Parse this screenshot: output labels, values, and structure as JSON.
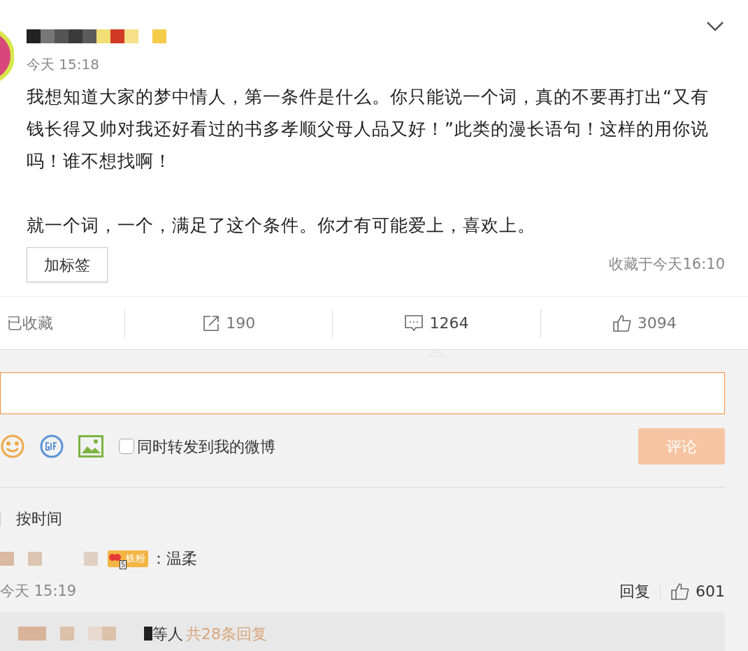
{
  "post": {
    "time": "今天 15:18",
    "paragraphs": [
      "我想知道大家的梦中情人，第一条件是什么。你只能说一个词，真的不要再打出“又有钱长得又帅对我还好看过的书多孝顺父母人品又好！”此类的漫长语句！这样的用你说吗！谁不想找啊！",
      "就一个词，一个，满足了这个条件。你才有可能爱上，喜欢上。"
    ],
    "tag_button": "加标签",
    "saved_time": "收藏于今天16:10"
  },
  "actions": [
    {
      "kind": "favorite",
      "label": "已收藏",
      "selected": false
    },
    {
      "kind": "repost",
      "label": "190",
      "selected": false
    },
    {
      "kind": "comment",
      "label": "1264",
      "selected": true
    },
    {
      "kind": "like",
      "label": "3094",
      "selected": false
    }
  ],
  "composer": {
    "forward_option": {
      "label": "同时转发到我的微博",
      "checked": false
    },
    "submit": "评论"
  },
  "sort": {
    "label": "按时间"
  },
  "comments": [
    {
      "badge_level": "5",
      "badge": "铁粉",
      "text": "：温柔",
      "time": "今天 15:19",
      "reply": "回复",
      "likes": "601",
      "replies_note": "等人",
      "replies_link": "共28条回复"
    }
  ]
}
